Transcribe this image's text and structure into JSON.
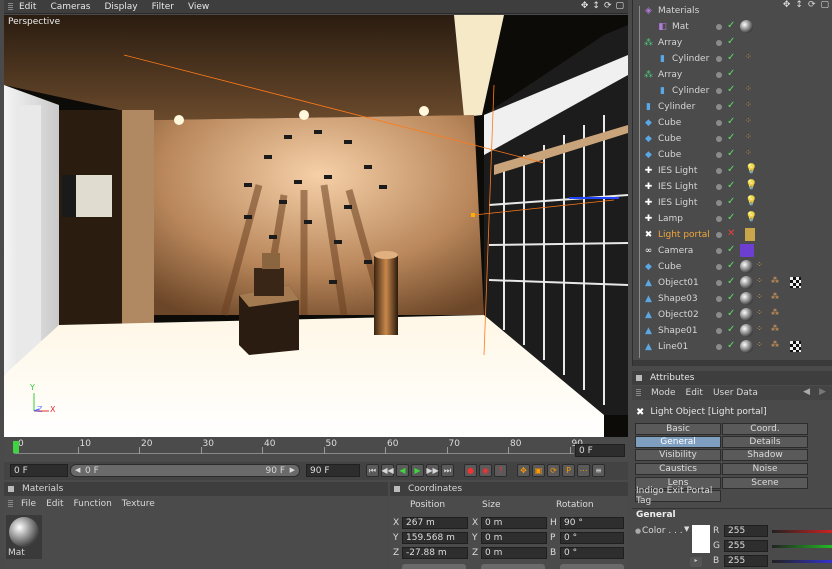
{
  "main_menu": [
    "Edit",
    "Cameras",
    "Display",
    "Filter",
    "View"
  ],
  "viewport": {
    "label": "Perspective",
    "axes": {
      "y": "Y",
      "z": "Z",
      "x": "X"
    }
  },
  "object_manager": {
    "items": [
      {
        "label": "Materials",
        "icon": "materials-icon",
        "indent": 0,
        "highlight": false
      },
      {
        "label": "Mat",
        "icon": "material-icon",
        "indent": 1,
        "highlight": false
      },
      {
        "label": "Array",
        "icon": "array-icon",
        "indent": 0,
        "highlight": false
      },
      {
        "label": "Cylinder",
        "icon": "cylinder-icon",
        "indent": 1,
        "highlight": false
      },
      {
        "label": "Array",
        "icon": "array-icon",
        "indent": 0,
        "highlight": false
      },
      {
        "label": "Cylinder",
        "icon": "cylinder-icon",
        "indent": 1,
        "highlight": false
      },
      {
        "label": "Cylinder",
        "icon": "cylinder-icon",
        "indent": 0,
        "highlight": false
      },
      {
        "label": "Cube",
        "icon": "cube-icon",
        "indent": 0,
        "highlight": false
      },
      {
        "label": "Cube",
        "icon": "cube-icon",
        "indent": 0,
        "highlight": false
      },
      {
        "label": "Cube",
        "icon": "cube-icon",
        "indent": 0,
        "highlight": false
      },
      {
        "label": "IES Light",
        "icon": "ies-light-icon",
        "indent": 0,
        "highlight": false
      },
      {
        "label": "IES Light",
        "icon": "ies-light-icon",
        "indent": 0,
        "highlight": false
      },
      {
        "label": "IES Light",
        "icon": "ies-light-icon",
        "indent": 0,
        "highlight": false
      },
      {
        "label": "Lamp",
        "icon": "lamp-icon",
        "indent": 0,
        "highlight": false
      },
      {
        "label": "Light portal",
        "icon": "light-portal-icon",
        "indent": 0,
        "highlight": true
      },
      {
        "label": "Camera",
        "icon": "camera-icon",
        "indent": 0,
        "highlight": false
      },
      {
        "label": "Cube",
        "icon": "cube-icon",
        "indent": 0,
        "highlight": false
      },
      {
        "label": "Object01",
        "icon": "object-icon",
        "indent": 0,
        "highlight": false
      },
      {
        "label": "Shape03",
        "icon": "shape-icon",
        "indent": 0,
        "highlight": false
      },
      {
        "label": "Object02",
        "icon": "object-icon",
        "indent": 0,
        "highlight": false
      },
      {
        "label": "Shape01",
        "icon": "shape-icon",
        "indent": 0,
        "highlight": false
      },
      {
        "label": "Line01",
        "icon": "line-icon",
        "indent": 0,
        "highlight": false
      }
    ]
  },
  "attributes": {
    "title": "Attributes",
    "menu": [
      "Mode",
      "Edit",
      "User Data"
    ],
    "object_title": "Light Object [Light portal]",
    "tabs": [
      [
        "Basic",
        "Coord."
      ],
      [
        "General",
        "Details"
      ],
      [
        "Visibility",
        "Shadow"
      ],
      [
        "Caustics",
        "Noise"
      ],
      [
        "Lens",
        "Scene"
      ]
    ],
    "selected_tab": "General",
    "extra_tab": "Indigo Exit Portal Tag",
    "section": "General",
    "color_label": "Color . . .",
    "rgb": [
      {
        "ch": "R",
        "val": "255"
      },
      {
        "ch": "G",
        "val": "255"
      },
      {
        "ch": "B",
        "val": "255"
      }
    ]
  },
  "timeline": {
    "ticks": [
      "0",
      "10",
      "20",
      "30",
      "40",
      "50",
      "60",
      "70",
      "80",
      "90"
    ],
    "current_frame": "0 F",
    "start": "0 F",
    "range_start": "0 F",
    "range_end": "90 F",
    "end": "90 F"
  },
  "materials_panel": {
    "title": "Materials",
    "menu": [
      "File",
      "Edit",
      "Function",
      "Texture"
    ],
    "material_name": "Mat"
  },
  "coordinates_panel": {
    "title": "Coordinates",
    "headers": [
      "Position",
      "Size",
      "Rotation"
    ],
    "rows": [
      {
        "axis": "X",
        "pos": "267 m",
        "size": "0 m",
        "rot_axis": "H",
        "rot": "90 °"
      },
      {
        "axis": "Y",
        "pos": "159.568 m",
        "size": "0 m",
        "rot_axis": "P",
        "rot": "0 °"
      },
      {
        "axis": "Z",
        "pos": "-27.88 m",
        "size": "0 m",
        "rot_axis": "B",
        "rot": "0 °"
      }
    ]
  },
  "colors": {
    "accent": "#7f9fc0",
    "highlight": "#f2a63a",
    "check": "#5fdc5f"
  }
}
